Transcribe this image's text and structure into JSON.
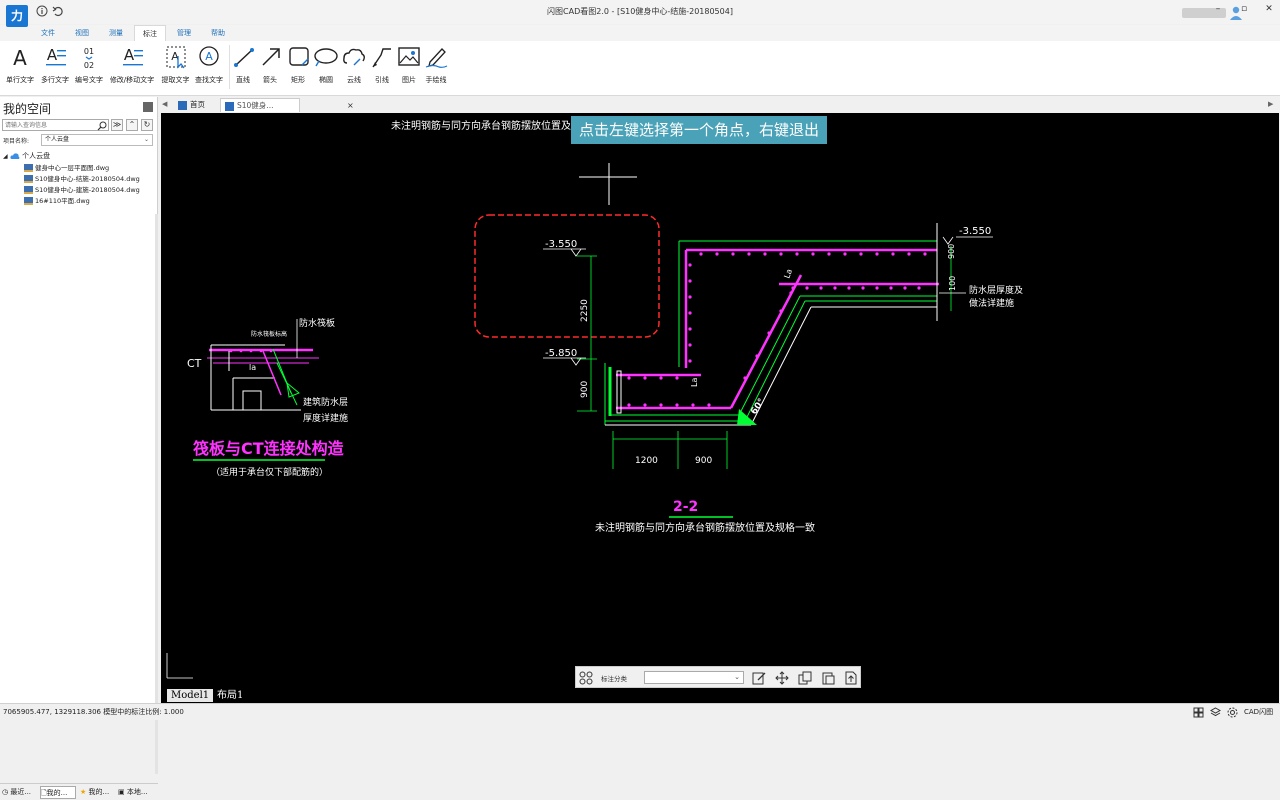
{
  "app": {
    "logo": "力",
    "title": "闪图CAD看图2.0 - [S10健身中心-结施-20180504]"
  },
  "window_controls": {
    "minimize": "–",
    "restore": "▫",
    "close": "✕"
  },
  "menu": {
    "tabs": [
      {
        "label": "文件"
      },
      {
        "label": "视图"
      },
      {
        "label": "测量"
      },
      {
        "label": "标注"
      },
      {
        "label": "管理"
      },
      {
        "label": "帮助"
      }
    ],
    "active": "标注"
  },
  "ribbon": {
    "items": [
      {
        "label": "单行文字",
        "icon": "single-line-text-icon"
      },
      {
        "label": "多行文字",
        "icon": "multi-line-text-icon"
      },
      {
        "label": "编号文字",
        "icon": "numbered-text-icon"
      },
      {
        "label": "修改/移动文字",
        "icon": "edit-move-text-icon"
      },
      {
        "label": "提取文字",
        "icon": "extract-text-icon"
      },
      {
        "label": "查找文字",
        "icon": "find-text-icon"
      },
      {
        "label": "直线",
        "icon": "line-icon"
      },
      {
        "label": "箭头",
        "icon": "arrow-icon"
      },
      {
        "label": "矩形",
        "icon": "rectangle-icon"
      },
      {
        "label": "椭圆",
        "icon": "ellipse-icon"
      },
      {
        "label": "云线",
        "icon": "cloud-line-icon"
      },
      {
        "label": "引线",
        "icon": "leader-line-icon"
      },
      {
        "label": "图片",
        "icon": "image-icon"
      },
      {
        "label": "手绘线",
        "icon": "freehand-icon"
      }
    ]
  },
  "sidebar": {
    "title": "我的空间",
    "search_placeholder": "请输入查询信息",
    "project_label": "项目名称:",
    "project_value": "个人云盘",
    "tree_root": "个人云盘",
    "files": [
      "健身中心一层平面图.dwg",
      "S10健身中心-结施-20180504.dwg",
      "S10健身中心-建施-20180504.dwg",
      "16#110平面.dwg"
    ],
    "bottom_tabs": [
      {
        "label": "最近..."
      },
      {
        "label": "我的..."
      },
      {
        "label": "我的..."
      },
      {
        "label": "本地..."
      }
    ]
  },
  "doc_tabs": {
    "home": "首页",
    "active": "S10健身...",
    "close": "×"
  },
  "canvas": {
    "tooltip": "点击左键选择第一个角点，右键退出",
    "top_note": "未注明钢筋与同方向承台钢筋摆放位置及规格一致",
    "left_detail": {
      "label_ct": "CT",
      "label_board": "防水筏板",
      "label_small": "防水筏板标高",
      "label_la": "la",
      "label_layer1": "建筑防水层",
      "label_layer2": "厚度详建施",
      "title": "筏板与CT连接处构造",
      "subtitle": "（适用于承台仅下部配筋的）"
    },
    "section": {
      "elev1": "-3.550",
      "elev2": "-5.850",
      "elev3": "-3.550",
      "dim_2250": "2250",
      "dim_900_left": "900",
      "dim_1200": "1200",
      "dim_900_bottom": "900",
      "dim_900_right": "900",
      "dim_100": "100",
      "la1": "La",
      "la2": "La",
      "angle": "60°",
      "note_r1": "防水层厚度及",
      "note_r2": "做法详建施",
      "title": "2-2",
      "bottom_note": "未注明钢筋与同方向承台钢筋摆放位置及规格一致"
    }
  },
  "annotation_toolbar": {
    "label": "标注分类",
    "select_value": ""
  },
  "layout_tabs": [
    {
      "label": "Model1"
    },
    {
      "label": "布局1"
    }
  ],
  "status": {
    "text": "7065905.477, 1329118.306 模型中的标注比例: 1.000",
    "brand": "CAD闪图"
  },
  "colors": {
    "canvas_bg": "#000000",
    "magenta": "#ff33ff",
    "green": "#00ff33",
    "red": "#ff2a2a",
    "white": "#ffffff",
    "tooltip_bg": "#4aa2b8",
    "accent": "#1976d2"
  }
}
